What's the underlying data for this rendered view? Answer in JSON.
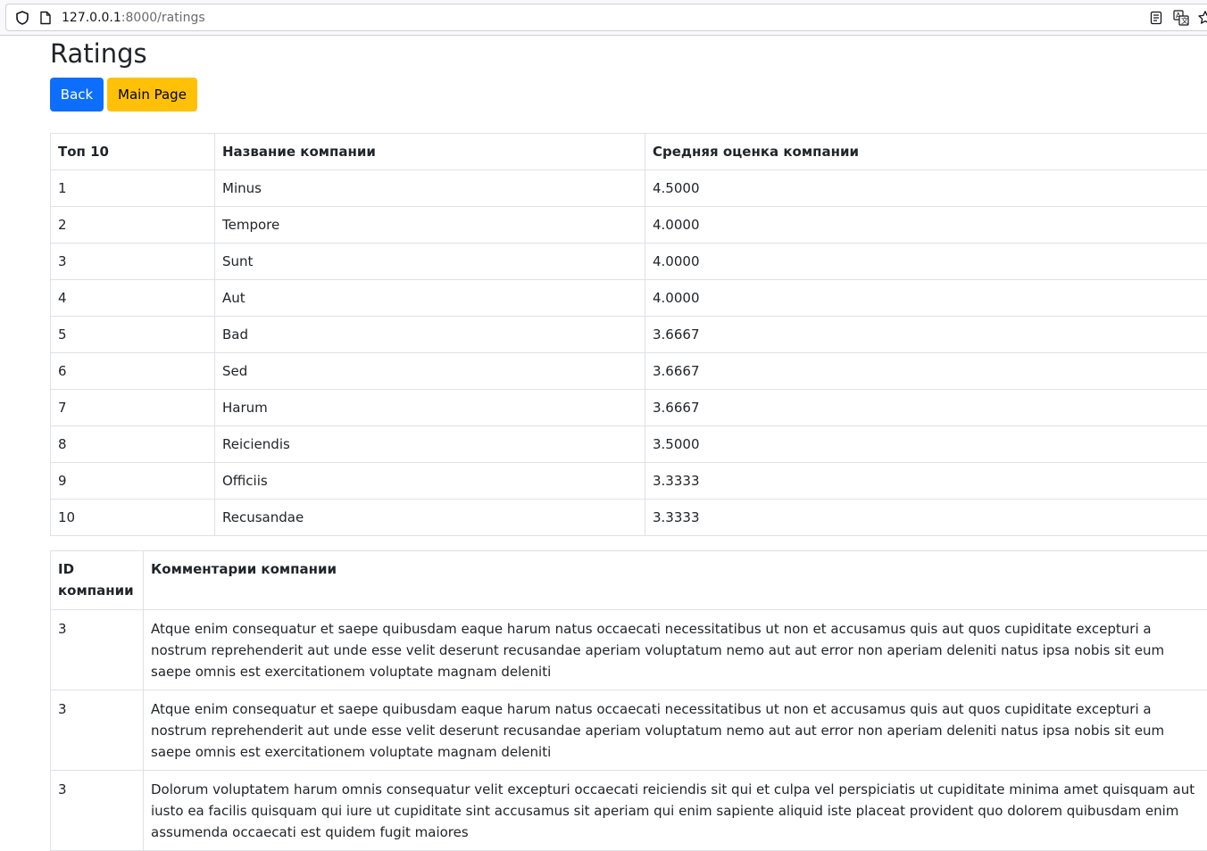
{
  "browser": {
    "url_host": "127.0.0.1",
    "url_rest": ":8000/ratings"
  },
  "page": {
    "title": "Ratings",
    "back_label": "Back",
    "main_page_label": "Main Page"
  },
  "ratings_table": {
    "headers": [
      "Топ 10",
      "Название компании",
      "Средняя оценка компании"
    ],
    "rows": [
      [
        "1",
        "Minus",
        "4.5000"
      ],
      [
        "2",
        "Tempore",
        "4.0000"
      ],
      [
        "3",
        "Sunt",
        "4.0000"
      ],
      [
        "4",
        "Aut",
        "4.0000"
      ],
      [
        "5",
        "Bad",
        "3.6667"
      ],
      [
        "6",
        "Sed",
        "3.6667"
      ],
      [
        "7",
        "Harum",
        "3.6667"
      ],
      [
        "8",
        "Reiciendis",
        "3.5000"
      ],
      [
        "9",
        "Officiis",
        "3.3333"
      ],
      [
        "10",
        "Recusandae",
        "3.3333"
      ]
    ]
  },
  "comments_table": {
    "headers": [
      "ID компании",
      "Комментарии компании"
    ],
    "rows": [
      [
        "3",
        "Atque enim consequatur et saepe quibusdam eaque harum natus occaecati necessitatibus ut non et accusamus quis aut quos cupiditate excepturi a nostrum reprehenderit aut unde esse velit deserunt recusandae aperiam voluptatum nemo aut aut error non aperiam deleniti natus ipsa nobis sit eum saepe omnis est exercitationem voluptate magnam deleniti"
      ],
      [
        "3",
        "Atque enim consequatur et saepe quibusdam eaque harum natus occaecati necessitatibus ut non et accusamus quis aut quos cupiditate excepturi a nostrum reprehenderit aut unde esse velit deserunt recusandae aperiam voluptatum nemo aut aut error non aperiam deleniti natus ipsa nobis sit eum saepe omnis est exercitationem voluptate magnam deleniti"
      ],
      [
        "3",
        "Dolorum voluptatem harum omnis consequatur velit excepturi occaecati reiciendis sit qui et culpa vel perspiciatis ut cupiditate minima amet quisquam aut iusto ea facilis quisquam qui iure ut cupiditate sint accusamus sit aperiam qui enim sapiente aliquid iste placeat provident quo dolorem quibusdam enim assumenda occaecati est quidem fugit maiores"
      ]
    ]
  },
  "colors": {
    "back_button": "#0d6efd",
    "main_page_button": "#ffc107",
    "border": "#dee2e6"
  },
  "icons": [
    "shield-icon",
    "page-icon",
    "reader-view-icon",
    "translate-icon",
    "bookmark-star-icon"
  ]
}
